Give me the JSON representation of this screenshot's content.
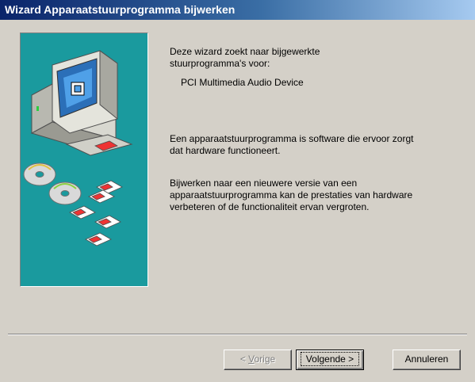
{
  "window": {
    "title": "Wizard Apparaatstuurprogramma bijwerken"
  },
  "content": {
    "intro_line1": "Deze wizard zoekt naar bijgewerkte",
    "intro_line2": "stuurprogramma's voor:",
    "device_name": "PCI Multimedia Audio Device",
    "paragraph1_line1": "Een apparaatstuurprogramma is software die ervoor zorgt",
    "paragraph1_line2": "dat hardware functioneert.",
    "paragraph2_line1": "Bijwerken naar een nieuwere versie van een",
    "paragraph2_line2": "apparaatstuurprogramma kan de prestaties van hardware",
    "paragraph2_line3": "verbeteren of de functionaliteit ervan vergroten."
  },
  "buttons": {
    "prev_prefix": "< ",
    "prev_accel": "V",
    "prev_rest": "orige",
    "next_label": "Volgende >",
    "cancel_label": "Annuleren"
  },
  "colors": {
    "dialog_bg": "#d4d0c8",
    "title_gradient_start": "#0a246a",
    "art_bg": "#1a9a9e"
  },
  "icons": [
    "computer-icon",
    "cd-disc-icon",
    "floppy-disk-icon"
  ]
}
